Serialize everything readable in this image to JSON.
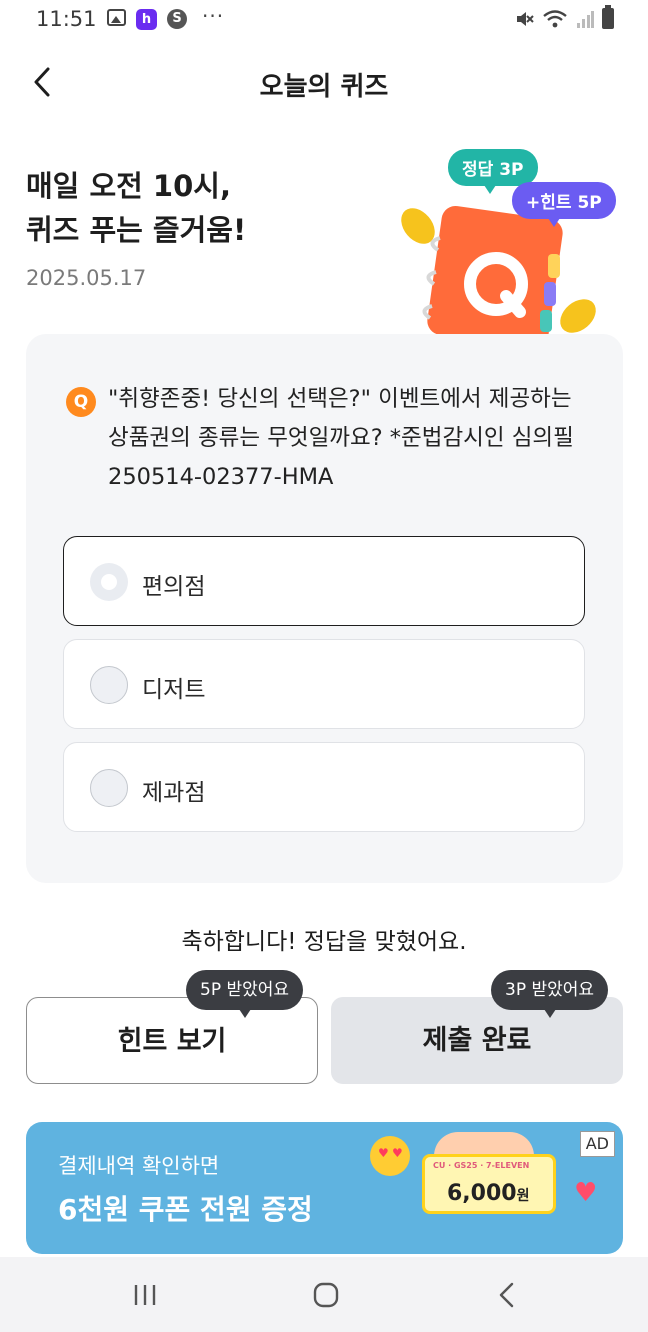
{
  "status_bar": {
    "time": "11:51",
    "more": "···",
    "h_app": "h",
    "s_app": "S"
  },
  "header": {
    "title": "오늘의 퀴즈"
  },
  "intro": {
    "heading_line1": "매일 오전 10시,",
    "heading_line2": "퀴즈 푸는 즐거움!",
    "date": "2025.05.17",
    "badge_correct": "정답 3P",
    "badge_hint": "+힌트 5P",
    "book_letter": "Q"
  },
  "quiz": {
    "q_badge": "Q",
    "question": "\"취향존중! 당신의 선택은?\" 이벤트에서 제공하는 상품권의 종류는 무엇일까요? *준법감시인 심의필250514-02377-HMA",
    "options": [
      {
        "label": "편의점",
        "selected": true
      },
      {
        "label": "디저트",
        "selected": false
      },
      {
        "label": "제과점",
        "selected": false
      }
    ]
  },
  "result": {
    "message": "축하합니다! 정답을 맞혔어요."
  },
  "actions": {
    "hint_button": "힌트 보기",
    "hint_tooltip": "5P 받았어요",
    "submit_button": "제출 완료",
    "submit_tooltip": "3P 받았어요"
  },
  "ad": {
    "line1": "결제내역 확인하면",
    "line2": "6천원 쿠폰 전원 증정",
    "tag": "AD",
    "ticket_brands": "CU · GS25 · 7-ELEVEN",
    "ticket_amount": "6,000",
    "ticket_unit": "원"
  },
  "colors": {
    "accent_orange": "#ff8a1e",
    "badge_green": "#22b5a6",
    "badge_purple": "#6b5cf2",
    "ad_blue": "#5fb3e0"
  }
}
